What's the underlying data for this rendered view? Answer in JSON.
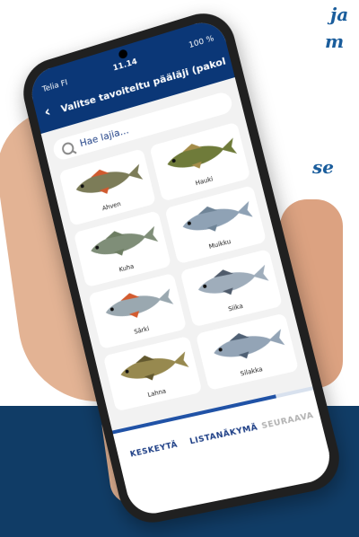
{
  "headline": {
    "line1": "ja",
    "line2": "m",
    "line3": "se"
  },
  "status": {
    "carrier": "Telia FI",
    "time": "11.14",
    "battery": "100 %"
  },
  "appbar": {
    "title": "Valitse tavoiteltu pääläji (pakollir"
  },
  "search": {
    "placeholder": "Hae lajia..."
  },
  "fish_options": [
    {
      "name": "Ahven",
      "icon": "perch-fish-icon"
    },
    {
      "name": "Hauki",
      "icon": "pike-fish-icon"
    },
    {
      "name": "Kuha",
      "icon": "zander-fish-icon"
    },
    {
      "name": "Muikku",
      "icon": "vendace-fish-icon"
    },
    {
      "name": "Särki",
      "icon": "roach-fish-icon"
    },
    {
      "name": "Siika",
      "icon": "whitefish-fish-icon"
    },
    {
      "name": "Lahna",
      "icon": "bream-fish-icon"
    },
    {
      "name": "Silakka",
      "icon": "herring-fish-icon"
    }
  ],
  "progress": {
    "value": 0.82
  },
  "footer": {
    "cancel": "KESKEYTÄ",
    "list_view": "LISTANÄKYMÄ",
    "next": "SEURAAVA"
  },
  "colors": {
    "brand": "#0b3777",
    "accent": "#1e3f86",
    "page_band": "#103c66",
    "disabled": "#b2b2b2"
  }
}
